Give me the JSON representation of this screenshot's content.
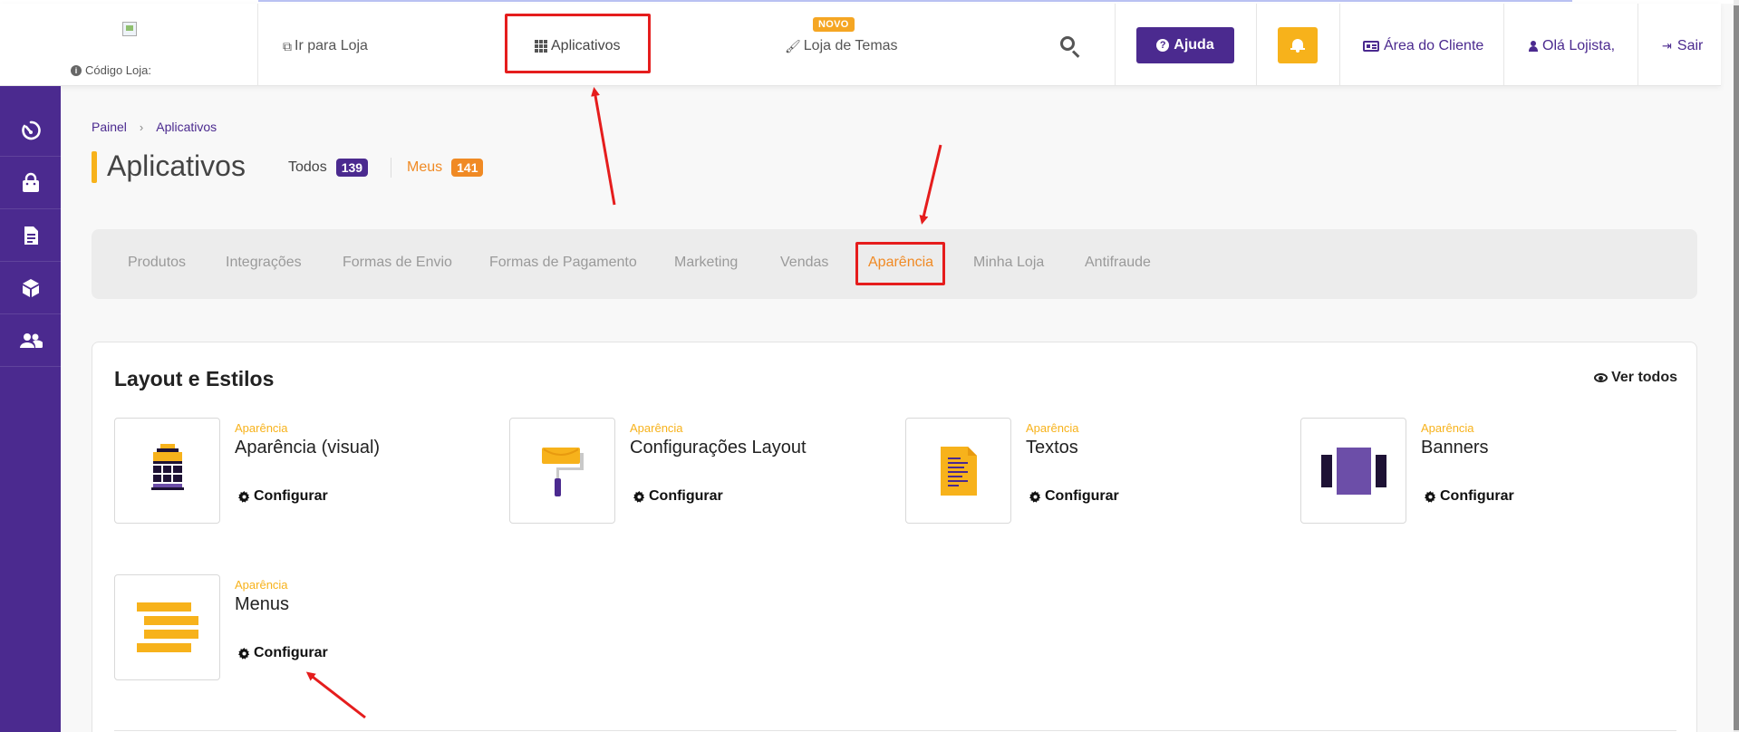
{
  "header": {
    "store_code_label": "Código Loja:",
    "go_to_store": "Ir para Loja",
    "apps": "Aplicativos",
    "themes_store": "Loja de Temas",
    "new_badge": "NOVO",
    "help": "Ajuda",
    "client_area": "Área do Cliente",
    "greeting": "Olá Lojista,",
    "logout": "Sair"
  },
  "sidebar": {
    "items": [
      {
        "icon": "dashboard-gauge-icon"
      },
      {
        "icon": "shopping-bag-icon"
      },
      {
        "icon": "document-icon"
      },
      {
        "icon": "box-icon"
      },
      {
        "icon": "users-icon"
      }
    ]
  },
  "breadcrumb": {
    "home": "Painel",
    "current": "Aplicativos"
  },
  "page": {
    "title": "Aplicativos",
    "filter_all_label": "Todos",
    "filter_all_count": "139",
    "filter_mine_label": "Meus",
    "filter_mine_count": "141"
  },
  "tabs": [
    {
      "label": "Produtos",
      "active": false
    },
    {
      "label": "Integrações",
      "active": false
    },
    {
      "label": "Formas de Envio",
      "active": false
    },
    {
      "label": "Formas de Pagamento",
      "active": false
    },
    {
      "label": "Marketing",
      "active": false
    },
    {
      "label": "Vendas",
      "active": false
    },
    {
      "label": "Aparência",
      "active": true
    },
    {
      "label": "Minha Loja",
      "active": false
    },
    {
      "label": "Antifraude",
      "active": false
    }
  ],
  "section": {
    "title": "Layout e Estilos",
    "see_all": "Ver todos",
    "apps": [
      {
        "category": "Aparência",
        "name": "Aparência (visual)",
        "action": "Configurar",
        "icon": "storefront-icon"
      },
      {
        "category": "Aparência",
        "name": "Configurações Layout",
        "action": "Configurar",
        "icon": "paint-roller-icon"
      },
      {
        "category": "Aparência",
        "name": "Textos",
        "action": "Configurar",
        "icon": "text-document-icon"
      },
      {
        "category": "Aparência",
        "name": "Banners",
        "action": "Configurar",
        "icon": "banner-slides-icon"
      },
      {
        "category": "Aparência",
        "name": "Menus",
        "action": "Configurar",
        "icon": "menu-bars-icon"
      }
    ]
  },
  "colors": {
    "brand_purple": "#4b2a8f",
    "accent_yellow": "#f7b21b",
    "accent_orange": "#f08a24",
    "annotation_red": "#e51d1d"
  }
}
